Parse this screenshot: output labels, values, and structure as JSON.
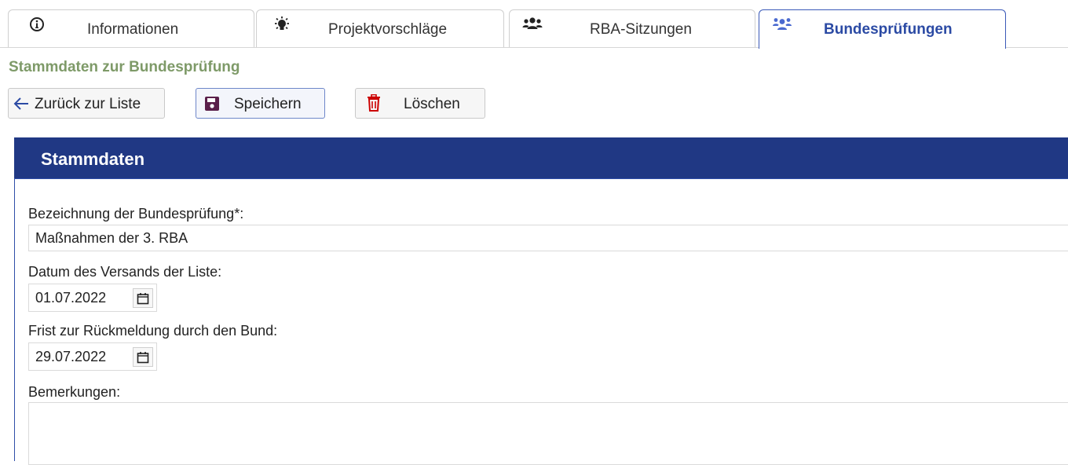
{
  "tabs": [
    {
      "label": "Informationen",
      "icon": "info-circle-icon",
      "active": false
    },
    {
      "label": "Projektvorschläge",
      "icon": "lightbulb-icon",
      "active": false
    },
    {
      "label": "RBA-Sitzungen",
      "icon": "users-icon",
      "active": false
    },
    {
      "label": "Bundesprüfungen",
      "icon": "users-group-icon",
      "active": true
    }
  ],
  "page_title": "Stammdaten zur Bundesprüfung",
  "toolbar": {
    "back_label": "Zurück zur Liste",
    "save_label": "Speichern",
    "delete_label": "Löschen"
  },
  "panel": {
    "title": "Stammdaten"
  },
  "form": {
    "bezeichnung_label": "Bezeichnung der Bundesprüfung*:",
    "bezeichnung_value": "Maßnahmen der 3. RBA",
    "versand_label": "Datum des Versands der Liste:",
    "versand_value": "01.07.2022",
    "frist_label": "Frist zur Rückmeldung durch den Bund:",
    "frist_value": "29.07.2022",
    "bemerkungen_label": "Bemerkungen:",
    "bemerkungen_value": ""
  },
  "colors": {
    "panel_header": "#203884",
    "page_title": "#7e9a68",
    "active_tab_text": "#2b4aa4",
    "delete_icon": "#cc0000",
    "save_icon": "#5a1f4a"
  }
}
